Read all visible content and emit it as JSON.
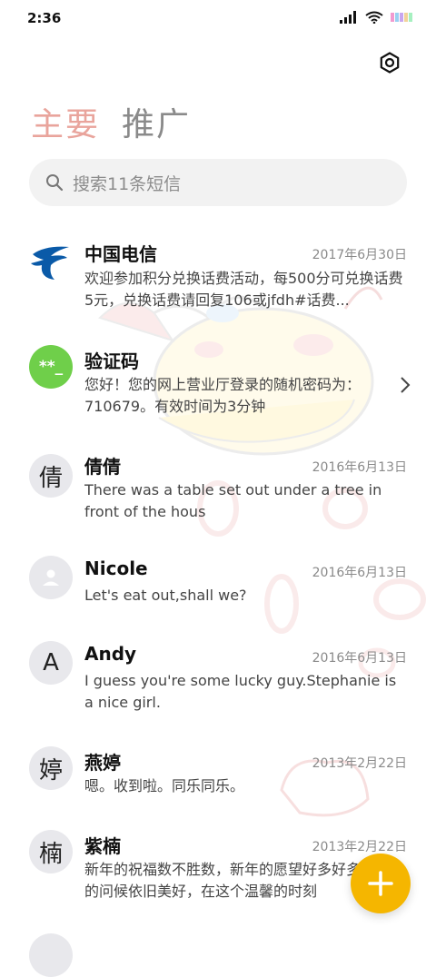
{
  "status_bar": {
    "time": "2:36"
  },
  "tabs": [
    {
      "label": "主要"
    },
    {
      "label": "推广"
    }
  ],
  "search": {
    "placeholder": "搜索11条短信"
  },
  "conversations": [
    {
      "name": "中国电信",
      "date": "2017年6月30日",
      "message": "欢迎参加积分兑换话费活动，每500分可兑换话费5元，兑换话费请回复106或jfdh#话费...",
      "avatar": "china-telecom-logo"
    },
    {
      "name": "验证码",
      "date": "",
      "message": "您好！您的网上营业厅登录的随机密码为：710679。有效时间为3分钟",
      "avatar_text": "**_"
    },
    {
      "name": "倩倩",
      "date": "2016年6月13日",
      "message": "There was a table set out under a tree in front of the hous",
      "avatar_text": "倩"
    },
    {
      "name": "Nicole",
      "date": "2016年6月13日",
      "message": "Let's eat out,shall we?",
      "avatar": "person-icon"
    },
    {
      "name": "Andy",
      "date": "2016年6月13日",
      "message": "I guess you're some lucky guy.Stephanie is a nice girl.",
      "avatar_text": "A"
    },
    {
      "name": "燕婷",
      "date": "2013年2月22日",
      "message": "嗯。收到啦。同乐同乐。",
      "avatar_text": "婷"
    },
    {
      "name": "紫楠",
      "date": "2013年2月22日",
      "message": "新年的祝福数不胜数，新年的愿望好多好多，新年的问候依旧美好，在这个温馨的时刻",
      "avatar_text": "楠"
    }
  ],
  "colors": {
    "tab_active": "#e9a49c",
    "verify_avatar": "#6fcf4a",
    "fab": "#f5b600",
    "telecom_blue": "#0a5aa8"
  }
}
